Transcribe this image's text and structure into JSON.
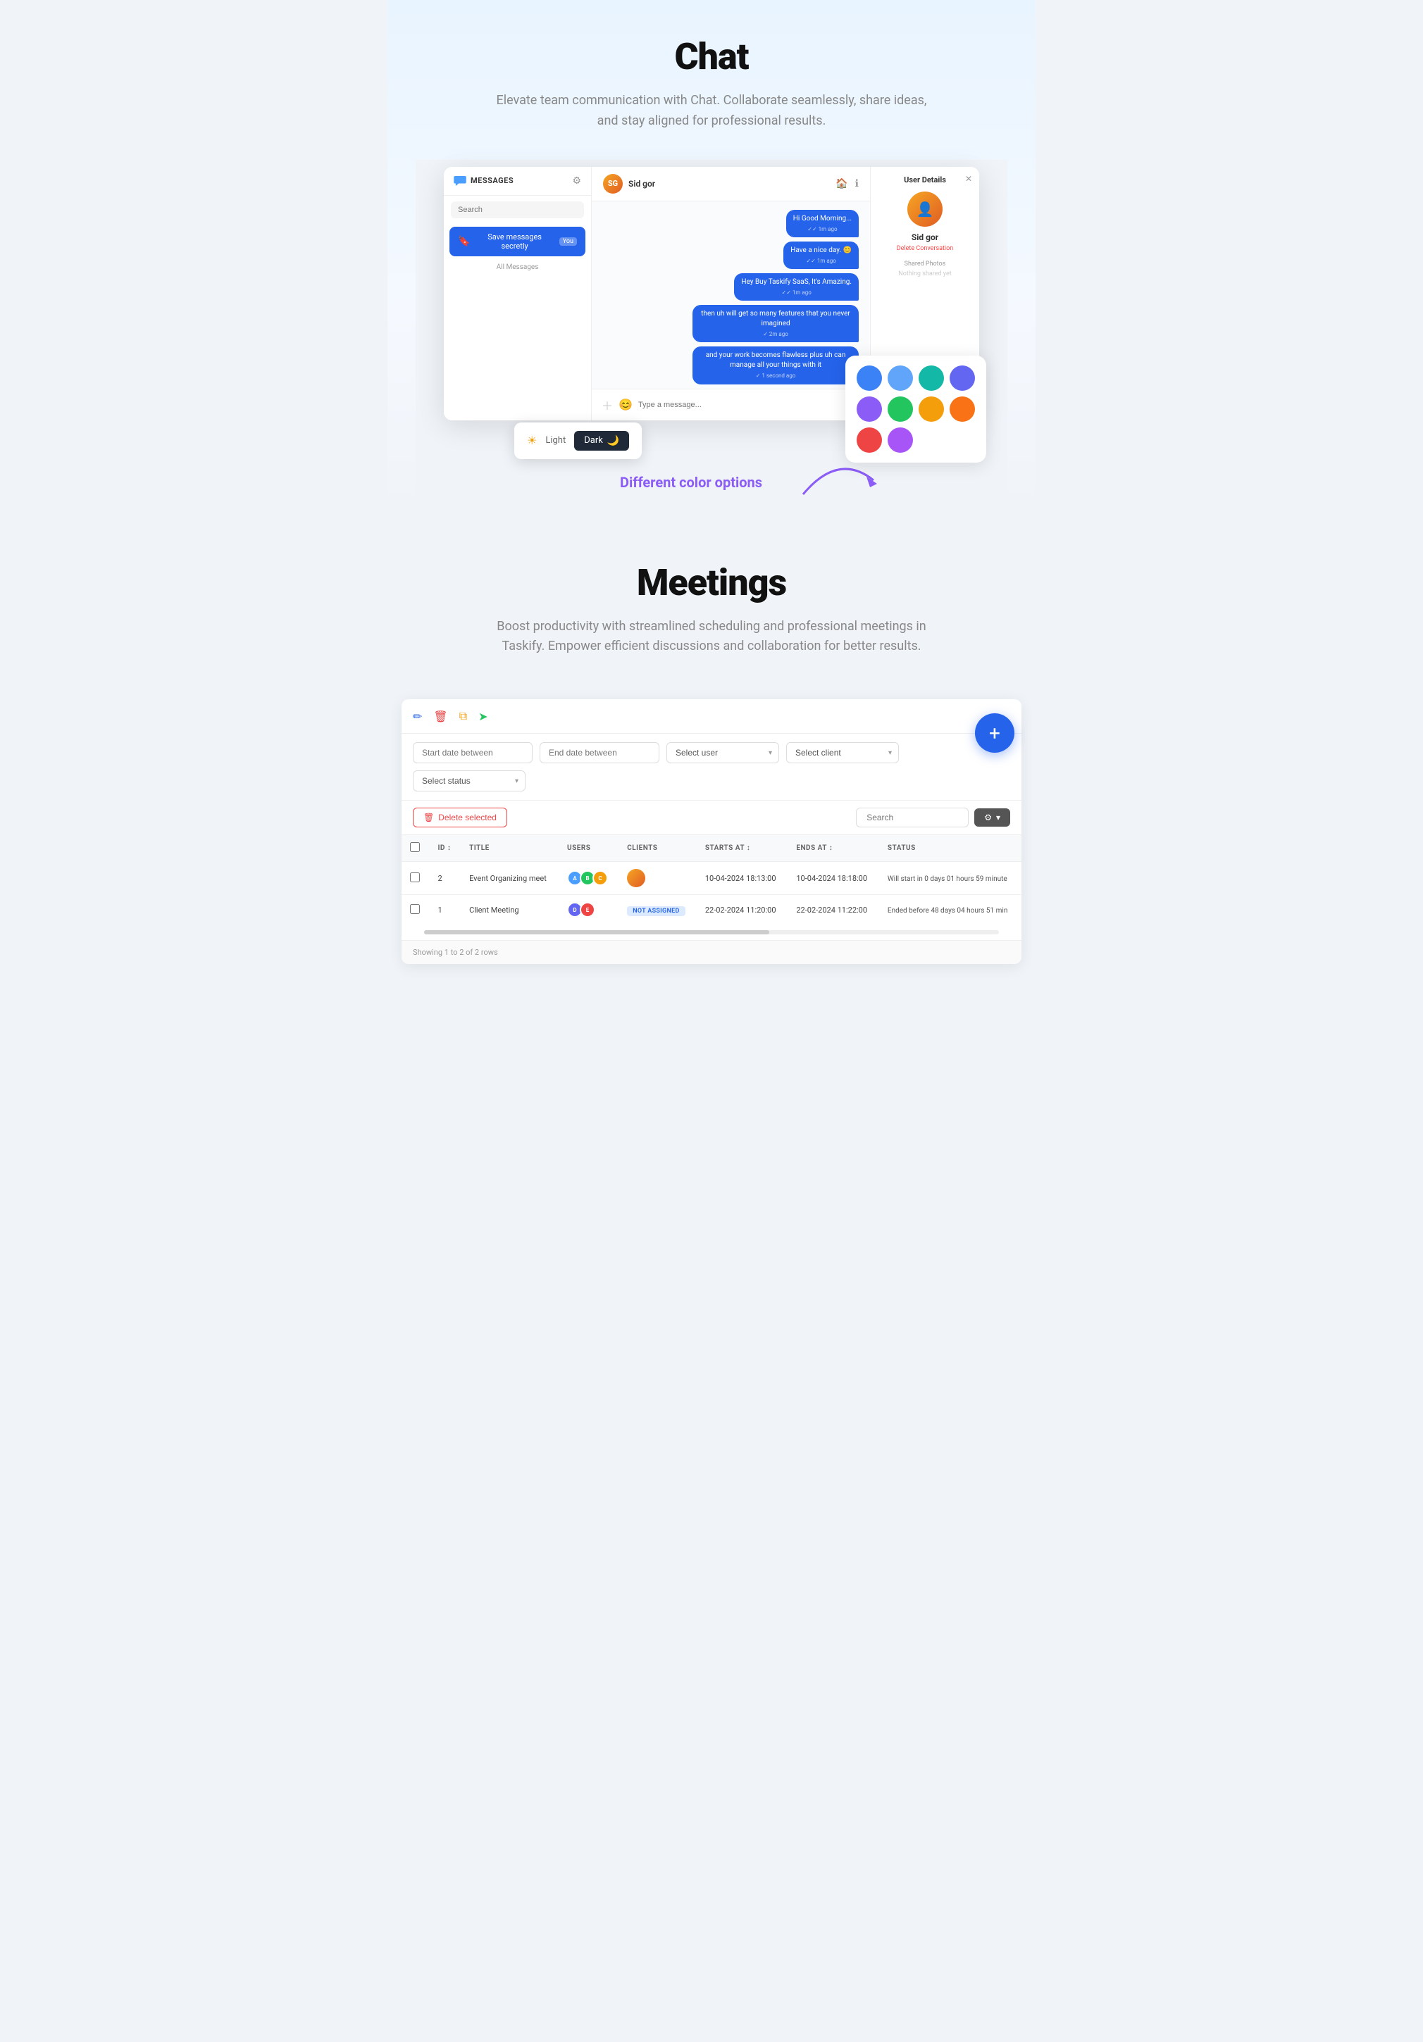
{
  "chat": {
    "title": "Chat",
    "subtitle": "Elevate team communication with Chat. Collaborate seamlessly, share ideas, and stay aligned for professional results.",
    "sidebar": {
      "section_label": "MESSAGES",
      "search_placeholder": "Search",
      "pinned_item": {
        "label": "Save messages secretly",
        "badge": "You"
      },
      "all_messages_label": "All Messages"
    },
    "header": {
      "user_name": "Sid gor",
      "panel_title": "User Details"
    },
    "messages": [
      {
        "text": "Hi Good Morning...",
        "meta": "✓✓ 1m ago"
      },
      {
        "text": "Have a nice day. 😊",
        "meta": "✓✓ 1m ago"
      },
      {
        "text": "Hey Buy Taskify SaaS, It's Amazing.",
        "meta": "✓✓ 1m ago"
      },
      {
        "text": "then uh will get so many features that you never imagined",
        "meta": "✓ 2m ago"
      },
      {
        "text": "and your work becomes flawless plus uh can manage all your things with it",
        "meta": "✓ 1 second ago"
      }
    ],
    "input_placeholder": "Type a message...",
    "panel": {
      "user_name": "Sid gor",
      "delete_link": "Delete Conversation",
      "shared_photos": "Shared Photos",
      "nothing_shared": "Nothing shared yet"
    },
    "theme_toggle": {
      "light_label": "Light",
      "dark_label": "Dark"
    },
    "color_options_label": "Different color options",
    "swatches": [
      "#3b82f6",
      "#60a5fa",
      "#14b8a6",
      "#6366f1",
      "#8b5cf6",
      "#22c55e",
      "#f59e0b",
      "#f97316",
      "#ef4444",
      "#a855f7"
    ]
  },
  "meetings": {
    "title": "Meetings",
    "subtitle": "Boost productivity with streamlined scheduling and professional meetings in Taskify. Empower efficient discussions and collaboration for better results.",
    "toolbar": {
      "edit_icon": "✏️",
      "delete_icon": "🗑",
      "copy_icon": "⧉",
      "arrow_icon": "➤"
    },
    "filters": {
      "start_date_placeholder": "Start date between",
      "end_date_placeholder": "End date between",
      "select_user_label": "Select user",
      "select_client_label": "Select client",
      "select_status_label": "Select status"
    },
    "actions": {
      "delete_selected": "Delete selected",
      "search_placeholder": "Search",
      "settings_label": "⚙"
    },
    "table": {
      "columns": [
        "",
        "ID",
        "TITLE",
        "USERS",
        "CLIENTS",
        "STARTS AT",
        "ENDS AT",
        "STATUS"
      ],
      "rows": [
        {
          "id": "2",
          "title": "Event Organizing meet",
          "users_count": 3,
          "has_client": true,
          "starts_at": "10-04-2024 18:13:00",
          "ends_at": "10-04-2024 18:18:00",
          "status": "Will start in 0 days 01 hours 59 minute"
        },
        {
          "id": "1",
          "title": "Client Meeting",
          "users_count": 2,
          "has_client": false,
          "starts_at": "22-02-2024 11:20:00",
          "ends_at": "22-02-2024 11:22:00",
          "status": "Ended before 48 days 04 hours 51 min",
          "not_assigned": true
        }
      ]
    },
    "footer": "Showing 1 to 2 of 2 rows"
  }
}
